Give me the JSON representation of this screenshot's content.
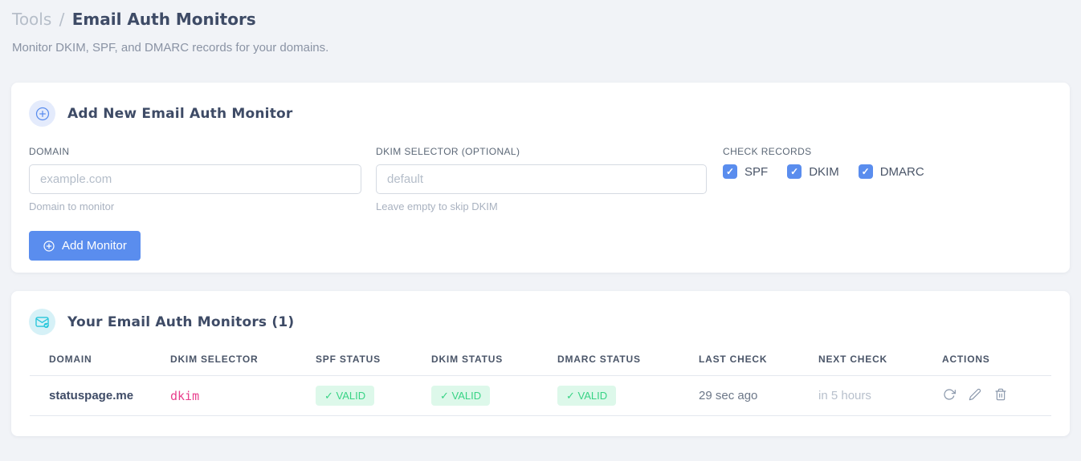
{
  "page": {
    "breadcrumb": {
      "section": "Tools",
      "separator": "/",
      "current": "Email Auth Monitors"
    },
    "subtitle": "Monitor DKIM, SPF, and DMARC records for your domains."
  },
  "add_form": {
    "title": "Add New Email Auth Monitor",
    "domain_field": {
      "label": "DOMAIN",
      "value": "",
      "placeholder": "example.com",
      "hint": "Domain to monitor"
    },
    "dkim_field": {
      "label": "DKIM SELECTOR (OPTIONAL)",
      "value": "",
      "placeholder": "default",
      "hint": "Leave empty to skip DKIM"
    },
    "check_records": {
      "label": "CHECK RECORDS",
      "options": [
        {
          "label": "SPF",
          "checked": true
        },
        {
          "label": "DKIM",
          "checked": true
        },
        {
          "label": "DMARC",
          "checked": true
        }
      ]
    },
    "submit_label": "Add Monitor"
  },
  "monitors": {
    "title": "Your Email Auth Monitors (1)",
    "count": 1,
    "table": {
      "columns": [
        "DOMAIN",
        "DKIM SELECTOR",
        "SPF STATUS",
        "DKIM STATUS",
        "DMARC STATUS",
        "LAST CHECK",
        "NEXT CHECK",
        "ACTIONS"
      ],
      "rows": [
        {
          "domain": "statuspage.me",
          "dkim_selector": "dkim",
          "spf_status": "✓ VALID",
          "dkim_status": "✓ VALID",
          "dmarc_status": "✓ VALID",
          "last_check": "29 sec ago",
          "next_check": "in 5 hours",
          "actions": [
            "refresh",
            "edit",
            "delete"
          ]
        }
      ]
    }
  },
  "colors": {
    "accent_blue": "#5a8dee",
    "accent_teal": "#26c6da",
    "success_text": "#38d385",
    "success_bg": "#ddf8ea",
    "selector_pink": "#e83e8c",
    "page_bg": "#f1f3f7"
  }
}
